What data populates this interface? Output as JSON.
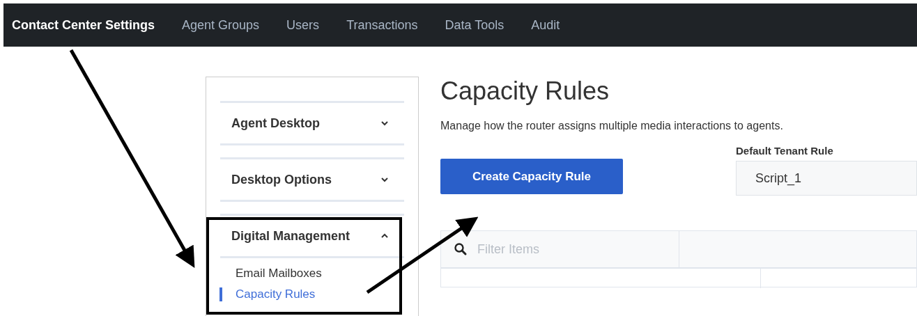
{
  "nav": {
    "brand": "Contact Center Settings",
    "items": [
      {
        "label": "Agent Groups",
        "selected": false
      },
      {
        "label": "Users",
        "selected": false
      },
      {
        "label": "Transactions",
        "selected": false
      },
      {
        "label": "Data Tools",
        "selected": false
      },
      {
        "label": "Audit",
        "selected": false
      }
    ]
  },
  "sidebar": {
    "sections": [
      {
        "title": "Agent Desktop",
        "expanded": false
      },
      {
        "title": "Desktop Options",
        "expanded": false
      },
      {
        "title": "Digital Management",
        "expanded": true,
        "items": [
          {
            "label": "Email Mailboxes",
            "selected": false
          },
          {
            "label": "Capacity Rules",
            "selected": true
          }
        ]
      }
    ]
  },
  "page": {
    "title": "Capacity Rules",
    "description": "Manage how the router assigns multiple media interactions to agents.",
    "create_button": "Create Capacity Rule",
    "default_rule": {
      "label": "Default Tenant Rule",
      "value": "Script_1"
    },
    "filter": {
      "placeholder": "Filter Items"
    }
  }
}
